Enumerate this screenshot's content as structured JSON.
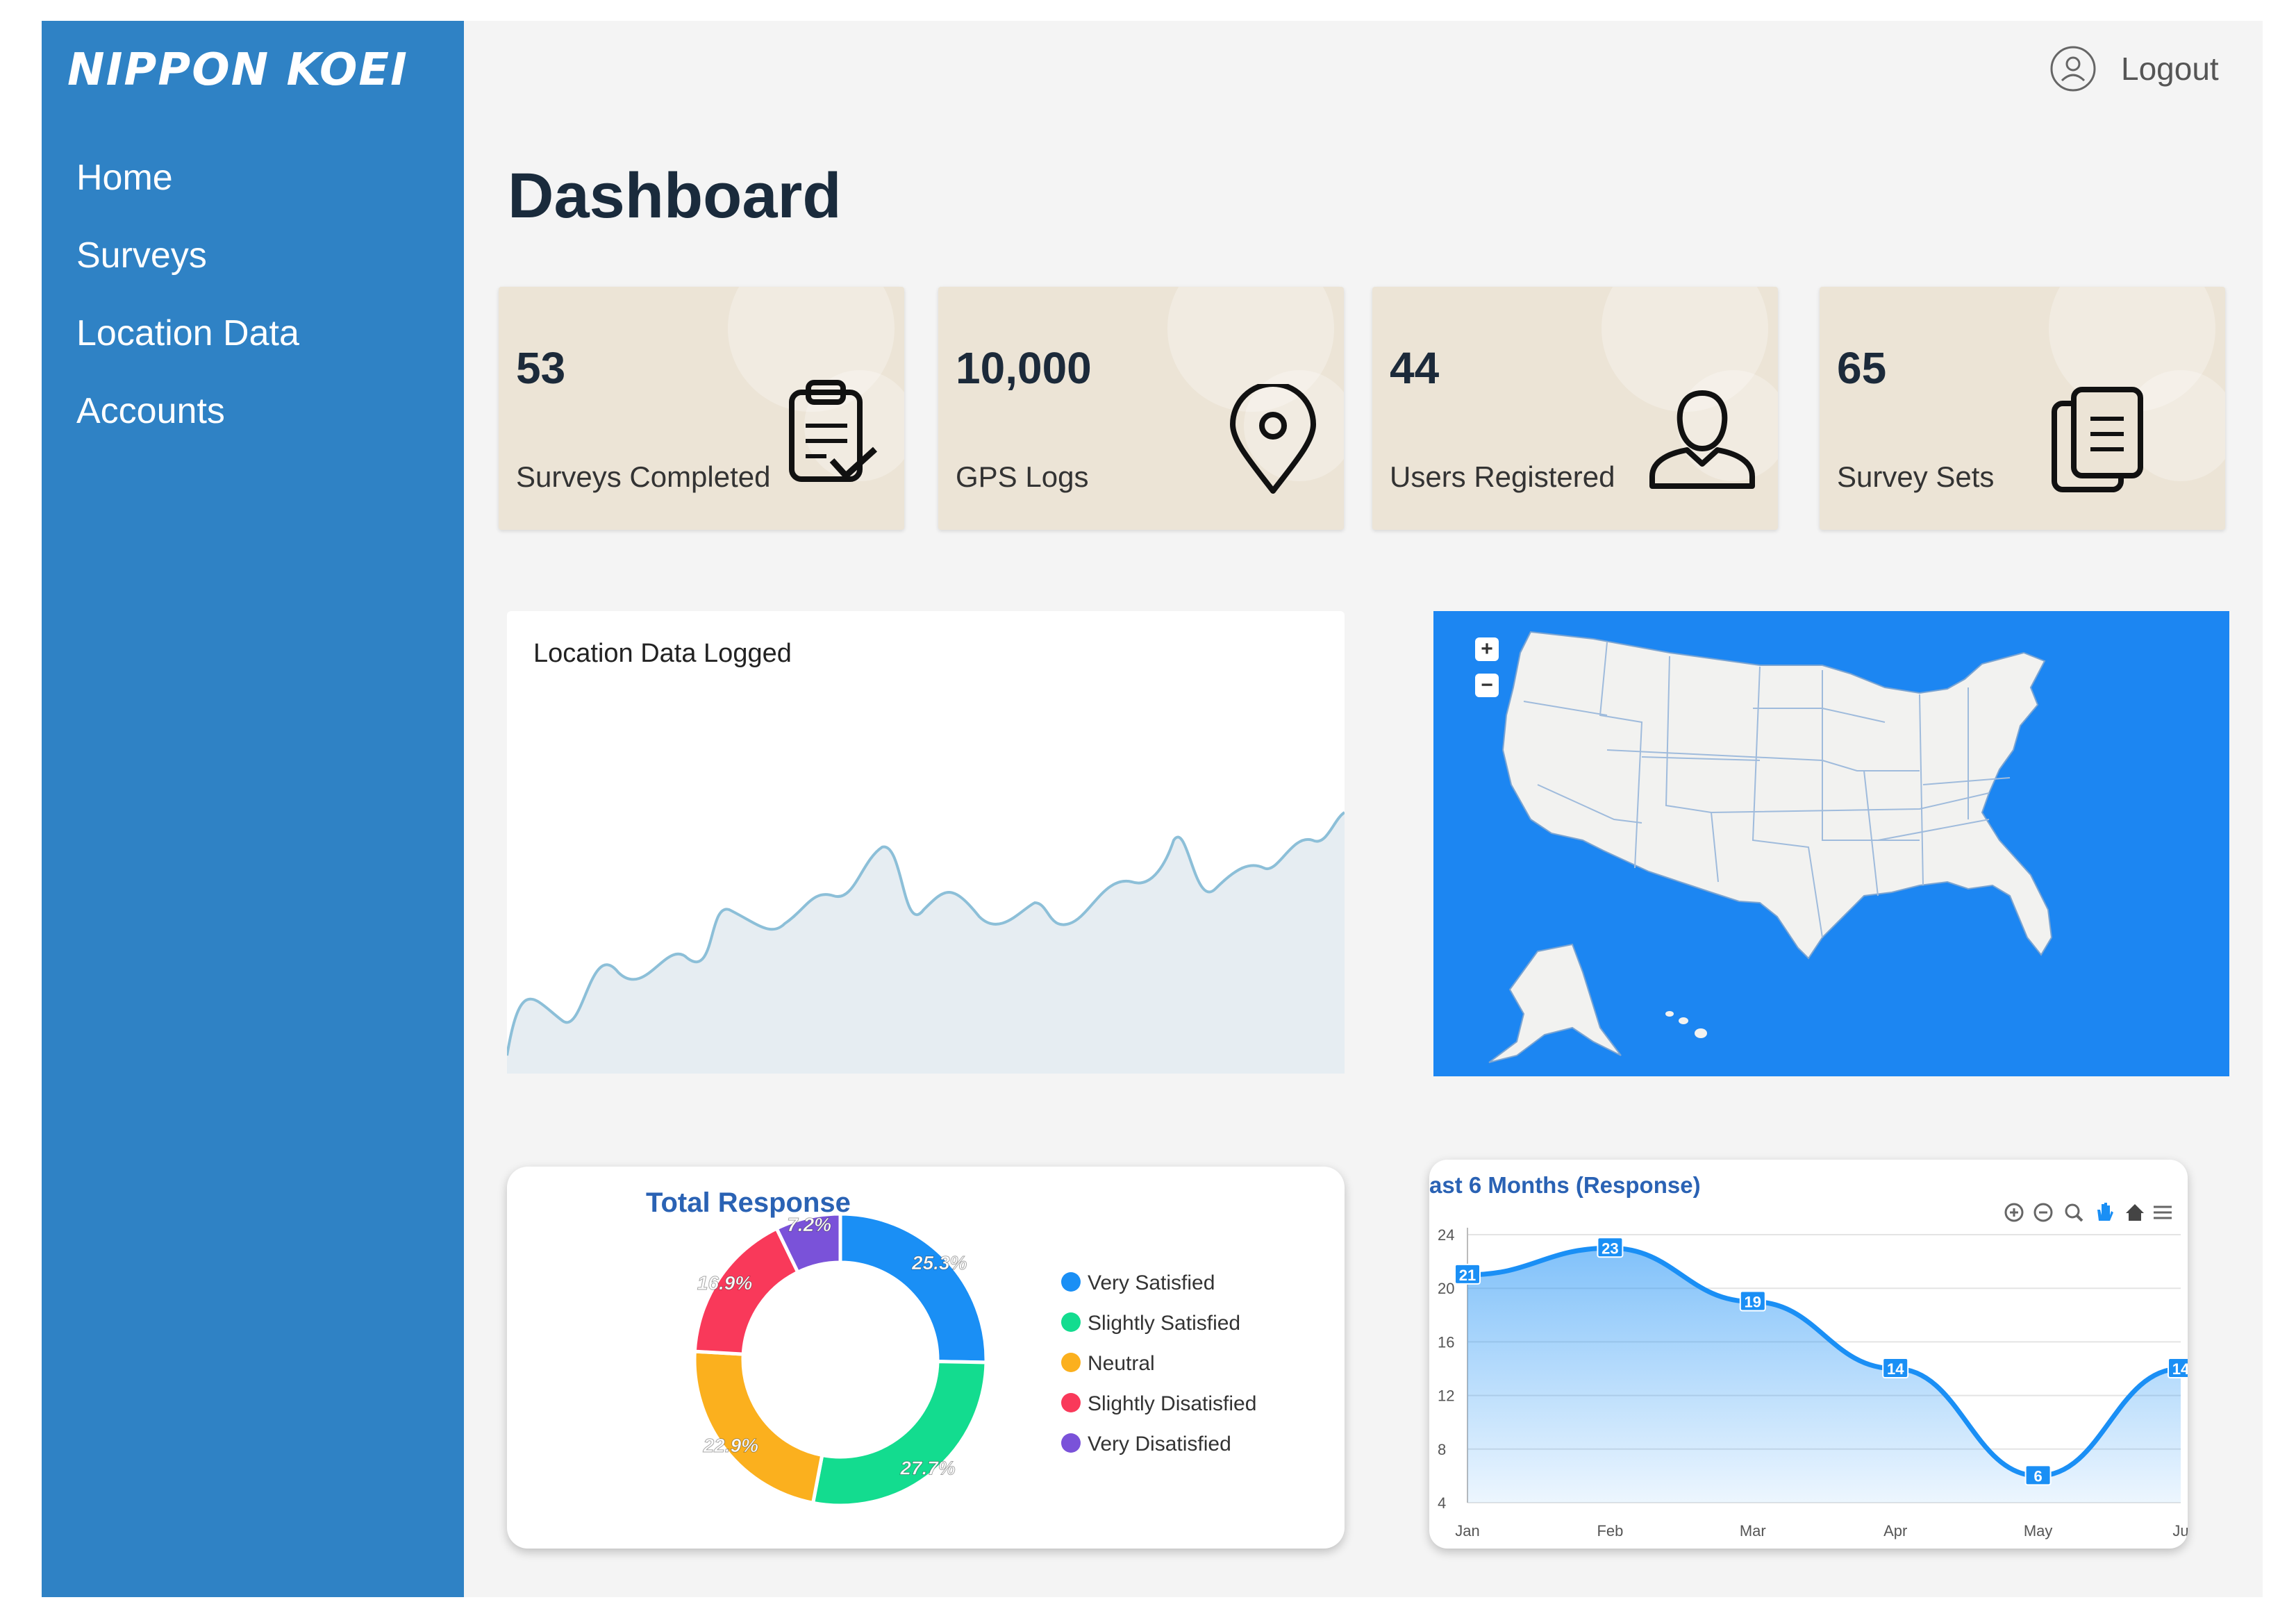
{
  "brand": {
    "name": "NIPPON KOEI"
  },
  "nav": {
    "items": [
      "Home",
      "Surveys",
      "Location Data",
      "Accounts"
    ]
  },
  "header": {
    "logout_label": "Logout"
  },
  "page_title": "Dashboard",
  "stats": [
    {
      "value": "53",
      "label": "Surveys Completed",
      "icon": "clipboard-check-icon"
    },
    {
      "value": "10,000",
      "label": "GPS Logs",
      "icon": "map-pin-icon"
    },
    {
      "value": "44",
      "label": "Users Registered",
      "icon": "user-icon"
    },
    {
      "value": "65",
      "label": "Survey Sets",
      "icon": "documents-icon"
    }
  ],
  "location_chart": {
    "title": "Location Data Logged",
    "note": "sparkline area chart, rising trend, no axes shown"
  },
  "map": {
    "zoom_in": "+",
    "zoom_out": "−",
    "background": "#1c86f2",
    "land": "#f2f2f0"
  },
  "colors": {
    "sidebar": "#2f82c5",
    "card_bg": "#ece4d6",
    "very_satisfied": "#1a8ff5",
    "slightly_satisfied": "#13dc8f",
    "neutral": "#fbb01e",
    "slightly_dissatisfied": "#f9395a",
    "very_dissatisfied": "#7a52d9",
    "line": "#1a8ff5"
  },
  "chart_data": [
    {
      "type": "pie",
      "title": "Total Response",
      "labels": [
        "Very Satisfied",
        "Slightly Satisfied",
        "Neutral",
        "Slightly Disatisfied",
        "Very Disatisfied"
      ],
      "values": [
        25.3,
        27.7,
        22.9,
        16.9,
        7.2
      ],
      "value_labels": [
        "25.3%",
        "27.7%",
        "22.9%",
        "16.9%",
        "7.2%"
      ],
      "legend_position": "right",
      "donut": true
    },
    {
      "type": "area",
      "title": "ast 6 Months (Response)",
      "categories": [
        "Jan",
        "Feb",
        "Mar",
        "Apr",
        "May",
        "Ju"
      ],
      "values": [
        21,
        23,
        19,
        14,
        6,
        14
      ],
      "ylim": [
        4,
        24
      ],
      "yticks": [
        "24",
        "20",
        "16",
        "12",
        "8",
        "4"
      ],
      "grid": true,
      "toolbar_icons": [
        "zoom-in-icon",
        "zoom-out-icon",
        "magnifier-icon",
        "pan-hand-icon",
        "home-icon",
        "menu-icon"
      ]
    }
  ]
}
